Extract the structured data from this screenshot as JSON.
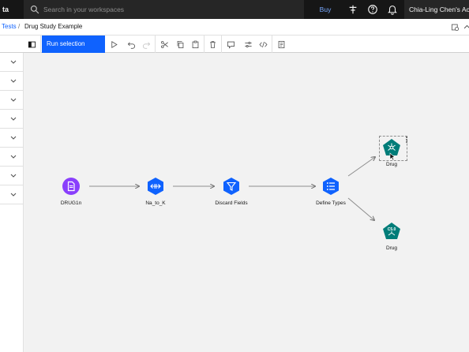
{
  "header": {
    "brand": "ta",
    "search_placeholder": "Search in your workspaces",
    "buy_label": "Buy",
    "account_label": "Chia-Ling Chen's Account"
  },
  "breadcrumb": {
    "parent": "Tests",
    "separator": "/",
    "current": "Drug Study Example"
  },
  "toolbar": {
    "run_selection_label": "Run selection"
  },
  "left_panel": {
    "row_count": 8
  },
  "flow": {
    "nodes": [
      {
        "id": "drug1n",
        "label": "DRUG1n",
        "kind": "data-import",
        "color": "#8a3ffc"
      },
      {
        "id": "na_to_k",
        "label": "Na_to_K",
        "kind": "derive",
        "color": "#0f62fe"
      },
      {
        "id": "discard",
        "label": "Discard Fields",
        "kind": "filter",
        "color": "#0f62fe"
      },
      {
        "id": "types",
        "label": "Define Types",
        "kind": "type",
        "color": "#0f62fe"
      },
      {
        "id": "drug_top",
        "label": "Drug",
        "kind": "model-neural",
        "color": "#007d79"
      },
      {
        "id": "drug_bottom",
        "label": "Drug",
        "kind": "model-c50",
        "color": "#007d79",
        "badge": "C5.0"
      }
    ]
  },
  "colors": {
    "accent": "#0f62fe",
    "header_bg": "#161616",
    "teal": "#007d79",
    "purple": "#8a3ffc"
  }
}
